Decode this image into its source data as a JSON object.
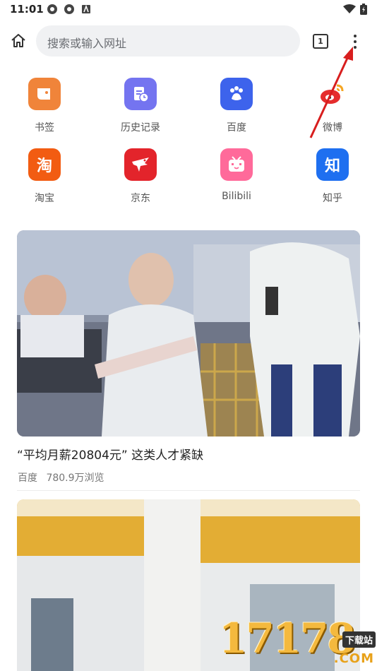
{
  "status_bar": {
    "time": "11:01"
  },
  "browser": {
    "search_placeholder": "搜索或输入网址",
    "tab_count": "1"
  },
  "shortcuts": [
    {
      "label": "书签",
      "color": "#f0843a"
    },
    {
      "label": "历史记录",
      "color": "#7474f0"
    },
    {
      "label": "百度",
      "color": "#3d63ec"
    },
    {
      "label": "微博",
      "color": "#e52d2d"
    },
    {
      "label": "淘宝",
      "color": "#f25c12",
      "glyph": "淘"
    },
    {
      "label": "京东",
      "color": "#e3242b"
    },
    {
      "label": "Bilibili",
      "color": "#ff6a9a"
    },
    {
      "label": "知乎",
      "color": "#1e6ff0",
      "glyph": "知"
    }
  ],
  "feed": [
    {
      "title": "“平均月薪20804元” 这类人才紧缺",
      "source": "百度",
      "views": "780.9万浏览"
    }
  ],
  "watermark": {
    "number": "17178",
    "tag": "下载站",
    "domain": ".COM"
  }
}
